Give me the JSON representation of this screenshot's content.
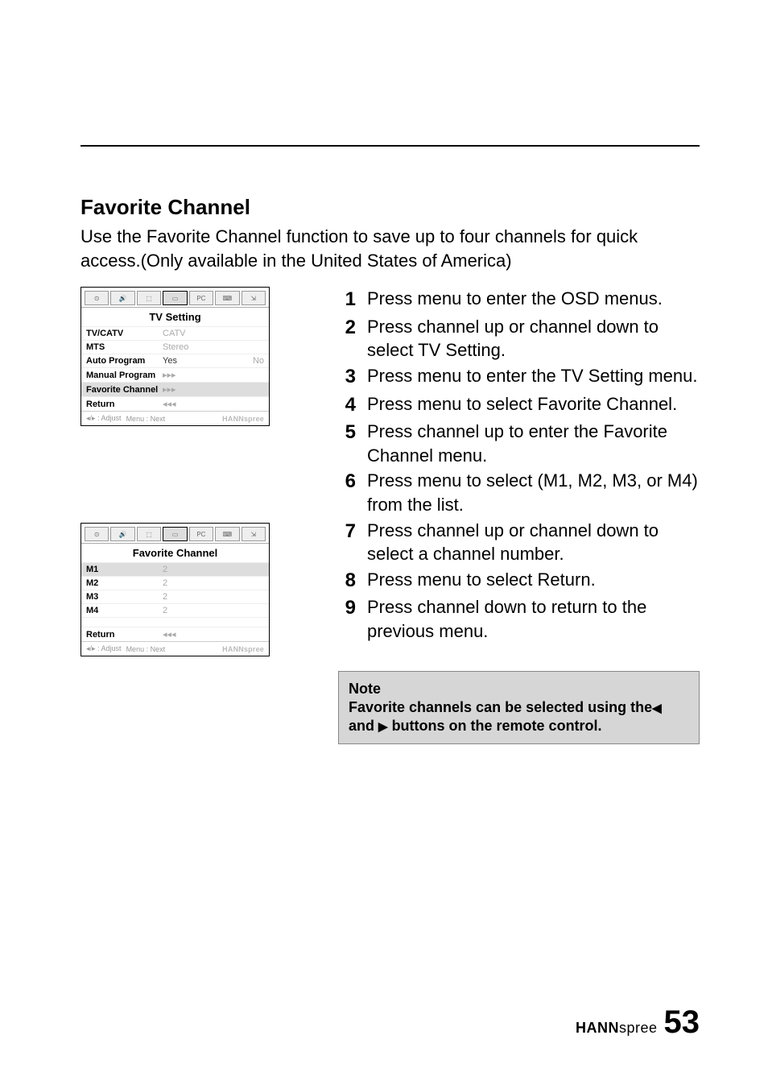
{
  "section": {
    "title": "Favorite Channel",
    "intro": "Use the Favorite Channel function to save up to four channels for quick access.(Only available in the United States of America)"
  },
  "osd1": {
    "title": "TV Setting",
    "icons": [
      "⊙",
      "🔊",
      "⬚",
      "▭",
      "PC",
      "⌨",
      "⇲"
    ],
    "rows": {
      "tvcatv": {
        "label": "TV/CATV",
        "value": "CATV"
      },
      "mts": {
        "label": "MTS",
        "value": "Stereo"
      },
      "autoprog": {
        "label": "Auto Program",
        "yes": "Yes",
        "no": "No"
      },
      "manprog": {
        "label": "Manual Program",
        "value": "▸▸▸"
      },
      "favch": {
        "label": "Favorite Channel",
        "value": "▸▸▸"
      },
      "return": {
        "label": "Return",
        "value": "◂◂◂"
      }
    },
    "footer": {
      "adjust": "◂/▸ : Adjust",
      "next": "Menu : Next",
      "brand": "HANNspree"
    }
  },
  "osd2": {
    "title": "Favorite Channel",
    "icons": [
      "⊙",
      "🔊",
      "⬚",
      "▭",
      "PC",
      "⌨",
      "⇲"
    ],
    "rows": {
      "m1": {
        "label": "M1",
        "value": "2"
      },
      "m2": {
        "label": "M2",
        "value": "2"
      },
      "m3": {
        "label": "M3",
        "value": "2"
      },
      "m4": {
        "label": "M4",
        "value": "2"
      },
      "return": {
        "label": "Return",
        "value": "◂◂◂"
      }
    },
    "footer": {
      "adjust": "◂/▸ : Adjust",
      "next": "Menu : Next",
      "brand": "HANNspree"
    }
  },
  "steps": [
    "Press menu to enter the OSD menus.",
    "Press channel up or channel down to select TV Setting.",
    "Press menu to enter the TV Setting menu.",
    "Press menu to select Favorite Channel.",
    "Press channel up to enter the Favorite Channel menu.",
    "Press menu to select (M1, M2, M3, or M4) from the list.",
    "Press channel up or channel down to select a channel number.",
    "Press menu to select Return.",
    "Press channel down to return to the previous menu."
  ],
  "note": {
    "label": "Note",
    "body_a": "Favorite channels can be selected using the",
    "body_b": " and ",
    "body_c": " buttons on the remote control."
  },
  "footer": {
    "brand_bold": "HANN",
    "brand_light": "spree",
    "page": "53"
  }
}
